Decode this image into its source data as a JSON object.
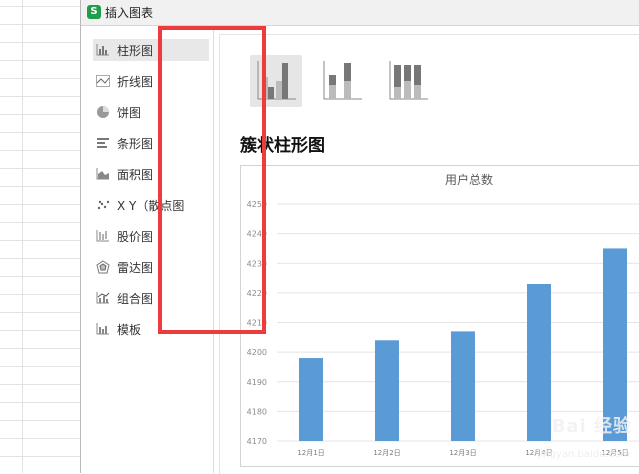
{
  "window": {
    "title": "插入图表",
    "app_icon": "S"
  },
  "sidebar": {
    "items": [
      {
        "label": "柱形图",
        "icon": "column-chart-icon",
        "active": true
      },
      {
        "label": "折线图",
        "icon": "line-chart-icon"
      },
      {
        "label": "饼图",
        "icon": "pie-chart-icon"
      },
      {
        "label": "条形图",
        "icon": "bar-chart-icon"
      },
      {
        "label": "面积图",
        "icon": "area-chart-icon"
      },
      {
        "label": "X Y（散点图",
        "icon": "scatter-chart-icon"
      },
      {
        "label": "股价图",
        "icon": "stock-chart-icon"
      },
      {
        "label": "雷达图",
        "icon": "radar-chart-icon"
      },
      {
        "label": "组合图",
        "icon": "combo-chart-icon"
      },
      {
        "label": "模板",
        "icon": "template-icon"
      }
    ]
  },
  "subtypes": [
    {
      "icon": "clustered-column-icon",
      "active": true
    },
    {
      "icon": "stacked-column-icon"
    },
    {
      "icon": "percent-stacked-column-icon"
    }
  ],
  "preview": {
    "subtype_title": "簇状柱形图"
  },
  "watermark": {
    "brand": "Bai 经验",
    "url": "jingyan.baidu.com"
  },
  "colors": {
    "bar": "#5b9bd5",
    "highlight_border": "#ee3b3b"
  },
  "chart_data": {
    "type": "bar",
    "title": "用户总数",
    "categories": [
      "12月1日",
      "12月2日",
      "12月3日",
      "12月4日",
      "12月5日"
    ],
    "values": [
      4198,
      4204,
      4207,
      4223,
      4235
    ],
    "ylim": [
      4170,
      4250
    ],
    "yticks": [
      4170,
      4180,
      4190,
      4200,
      4210,
      4220,
      4230,
      4240,
      4250
    ],
    "grid": true
  }
}
